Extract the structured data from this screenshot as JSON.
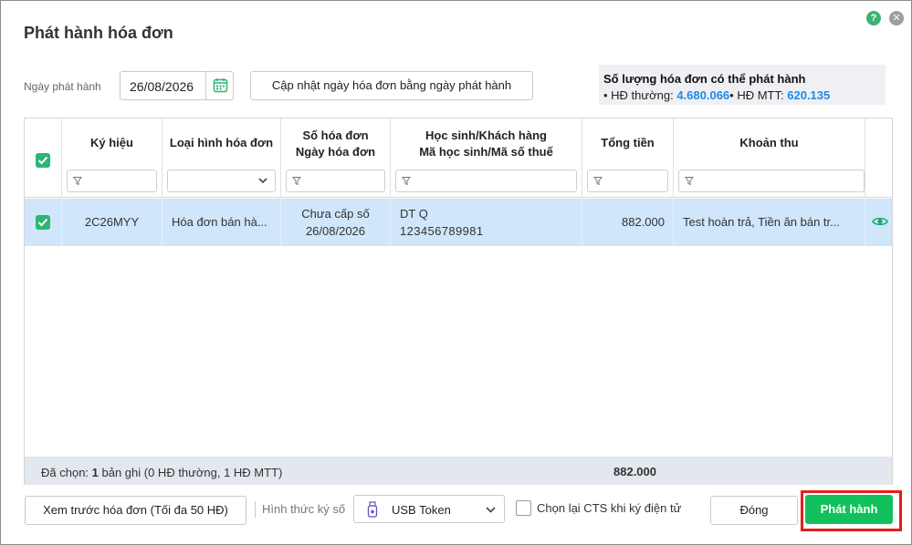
{
  "dialog": {
    "title": "Phát hành hóa đơn",
    "help_icon": "help-icon",
    "close_icon": "close-icon"
  },
  "issue_date": {
    "label": "Ngày phát hành",
    "value": "26/08/2026",
    "update_button": "Cập nhật ngày hóa đơn bằng ngày phát hành"
  },
  "quota": {
    "title": "Số lượng hóa đơn có thể phát hành",
    "regular_label": "HĐ thường:",
    "regular_value": "4.680.066",
    "mtt_label": "HĐ MTT:",
    "mtt_value": "620.135"
  },
  "table": {
    "columns": [
      {
        "key": "symbol",
        "label": "Ký hiệu",
        "filter": "text"
      },
      {
        "key": "type",
        "label": "Loại hình hóa đơn",
        "filter": "select"
      },
      {
        "key": "number_date",
        "label_line1": "Số hóa đơn",
        "label_line2": "Ngày hóa đơn",
        "filter": "text"
      },
      {
        "key": "student",
        "label_line1": "Học sinh/Khách hàng",
        "label_line2": "Mã học sinh/Mã số thuế",
        "filter": "text"
      },
      {
        "key": "total",
        "label": "Tổng tiền",
        "filter": "text"
      },
      {
        "key": "items",
        "label": "Khoản thu",
        "filter": "text"
      }
    ],
    "rows": [
      {
        "checked": true,
        "symbol": "2C26MYY",
        "type": "Hóa đơn bán hà...",
        "number": "Chưa cấp số",
        "date": "26/08/2026",
        "student_name": "DT Q",
        "student_code": "123456789981",
        "total": "882.000",
        "items": "Test hoàn trả, Tiền ăn bán tr..."
      }
    ],
    "footer": {
      "prefix": "Đã chọn: ",
      "count": "1",
      "suffix": " bản ghi (0 HĐ thường, 1 HĐ MTT)",
      "total": "882.000"
    }
  },
  "bottom_bar": {
    "preview_button": "Xem trước hóa đơn (Tối đa 50 HĐ)",
    "sign_label": "Hình thức ký số",
    "sign_value": "USB Token",
    "recheck_label": "Chọn lại CTS khi ký điện tử",
    "close_button": "Đóng",
    "issue_button": "Phát hành"
  },
  "colors": {
    "accent_green": "#12c15e",
    "checkbox_green": "#2bb673",
    "highlight_red": "#e0201b",
    "number_blue": "#1f8ae6",
    "row_selected": "#cfe6fb"
  }
}
